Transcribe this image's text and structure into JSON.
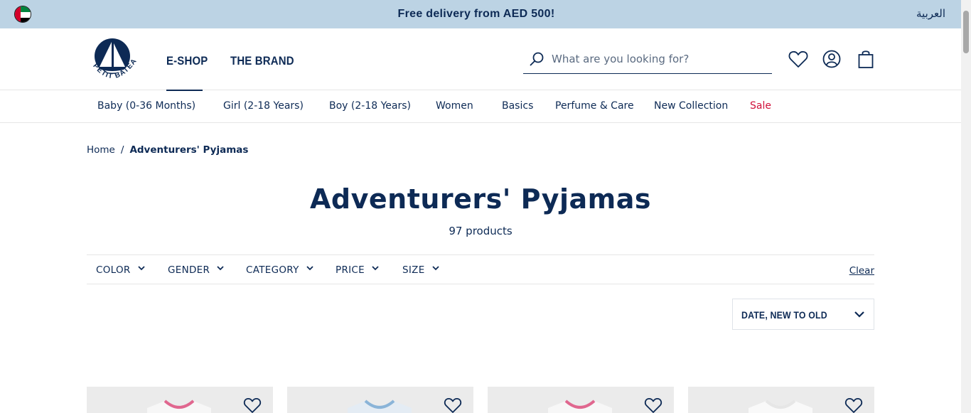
{
  "banner": {
    "promo": "Free delivery from AED 500!",
    "language": "العربية",
    "flag_icon": "uae-flag-icon"
  },
  "header": {
    "logo_text": "PETIT BATEAU",
    "nav": {
      "eshop": "E-SHOP",
      "brand": "THE BRAND"
    },
    "search": {
      "placeholder": "What are you looking for?"
    },
    "icons": [
      "heart-icon",
      "account-icon",
      "bag-icon"
    ]
  },
  "categories": [
    {
      "label": "Baby (0-36 Months)"
    },
    {
      "label": "Girl (2-18 Years)"
    },
    {
      "label": "Boy (2-18 Years)"
    },
    {
      "label": "Women"
    },
    {
      "label": "Basics"
    },
    {
      "label": "Perfume & Care"
    },
    {
      "label": "New Collection"
    },
    {
      "label": "Sale"
    }
  ],
  "breadcrumb": {
    "home": "Home",
    "separator": "/",
    "current": "Adventurers' Pyjamas"
  },
  "page": {
    "title": "Adventurers' Pyjamas",
    "count": "97 products"
  },
  "filters": {
    "items": [
      {
        "label": "COLOR"
      },
      {
        "label": "GENDER"
      },
      {
        "label": "CATEGORY"
      },
      {
        "label": "PRICE"
      },
      {
        "label": "SIZE"
      }
    ],
    "clear": "Clear"
  },
  "sort": {
    "selected": "DATE, NEW TO OLD"
  },
  "colors": {
    "navy": "#0d2a55",
    "banner_bg": "#bcd3e4",
    "sale_red": "#d0103a",
    "card_bg": "#ebebeb"
  },
  "products": [
    {
      "collar_color": "#e0678f"
    },
    {
      "collar_color": "#8ab4d8"
    },
    {
      "collar_color": "#e0678f"
    },
    {
      "collar_color": "#f2f2f2"
    }
  ]
}
